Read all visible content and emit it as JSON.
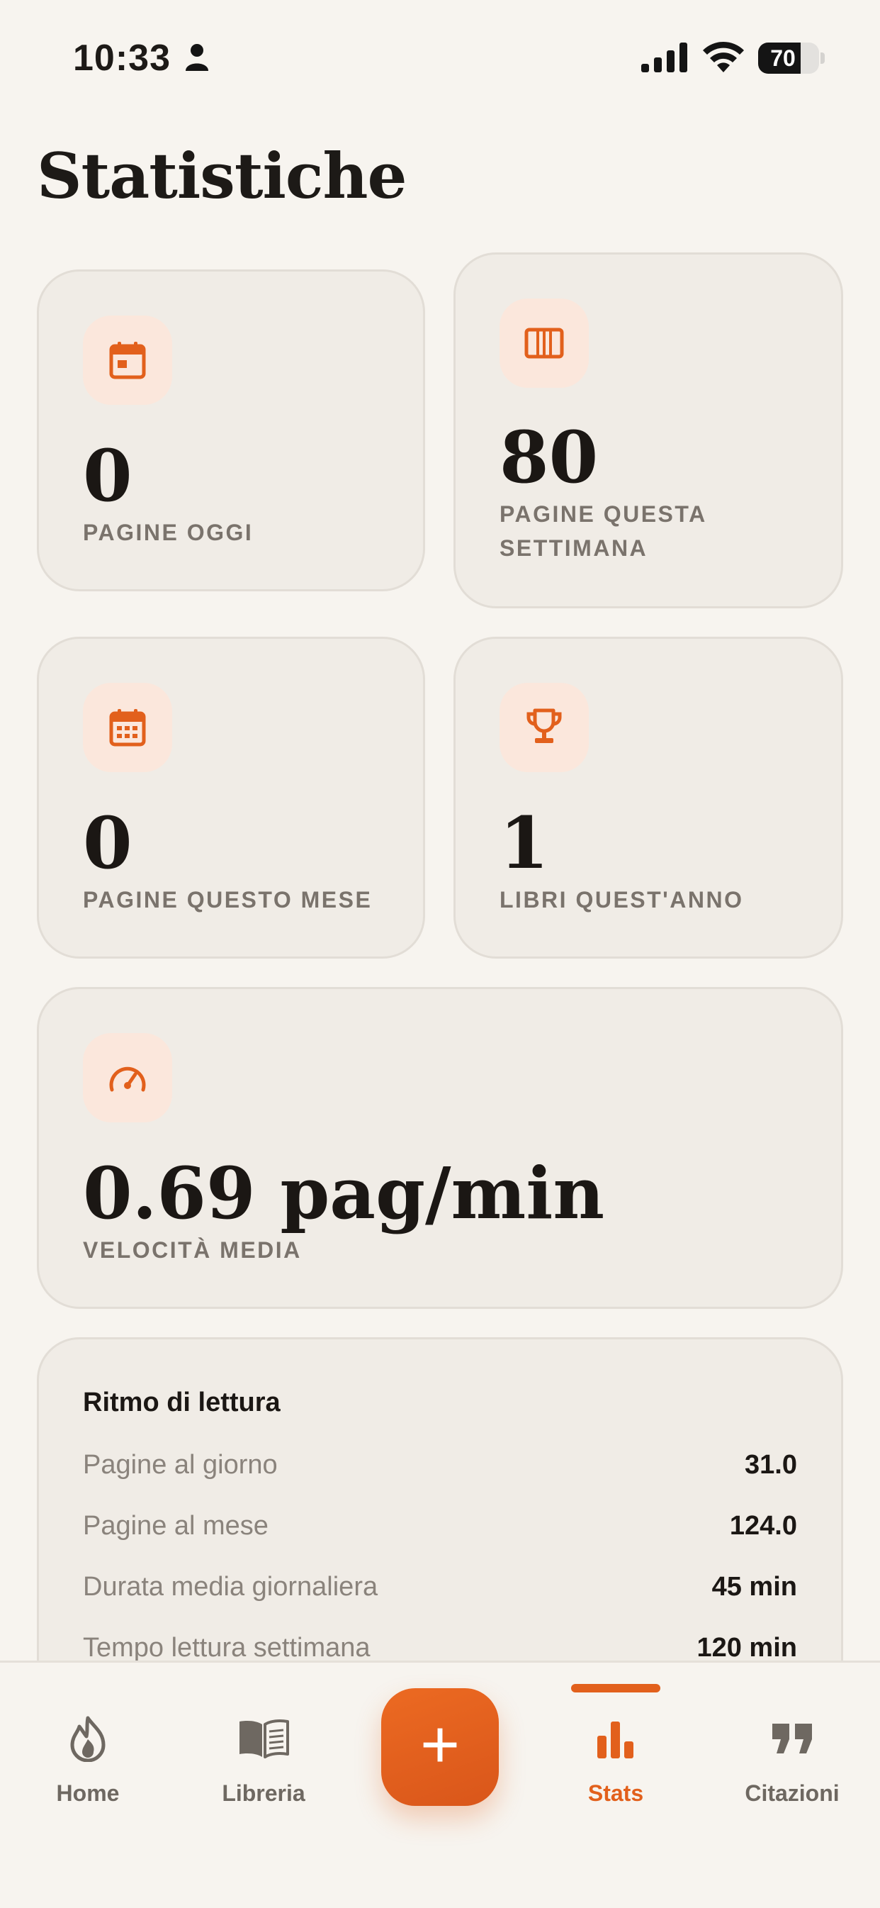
{
  "status_bar": {
    "time": "10:33",
    "battery": "70",
    "battery_level": 0.7
  },
  "page": {
    "title": "Statistiche"
  },
  "stats": {
    "today": {
      "value": "0",
      "label": "PAGINE OGGI"
    },
    "week": {
      "value": "80",
      "label": "PAGINE QUESTA SETTIMANA"
    },
    "month": {
      "value": "0",
      "label": "PAGINE QUESTO MESE"
    },
    "year": {
      "value": "1",
      "label": "LIBRI QUEST'ANNO"
    },
    "speed": {
      "value": "0.69 pag/min",
      "label": "VELOCITÀ MEDIA"
    }
  },
  "rhythm": {
    "title": "Ritmo di lettura",
    "rows": [
      {
        "label": "Pagine al giorno",
        "value": "31.0"
      },
      {
        "label": "Pagine al mese",
        "value": "124.0"
      },
      {
        "label": "Durata media giornaliera",
        "value": "45 min"
      },
      {
        "label": "Tempo lettura settimana",
        "value": "120 min"
      }
    ]
  },
  "tabbar": {
    "tabs": [
      {
        "label": "Home",
        "icon": "flame-icon"
      },
      {
        "label": "Libreria",
        "icon": "book-icon"
      },
      {
        "label": "Stats",
        "icon": "bar-chart-icon",
        "active": true
      },
      {
        "label": "Citazioni",
        "icon": "quote-icon"
      }
    ],
    "fab_symbol": "+"
  },
  "colors": {
    "accent": "#e2601c",
    "background": "#f7f4ef",
    "card": "#f0ece6",
    "icon_bg": "#fbe7dc"
  }
}
